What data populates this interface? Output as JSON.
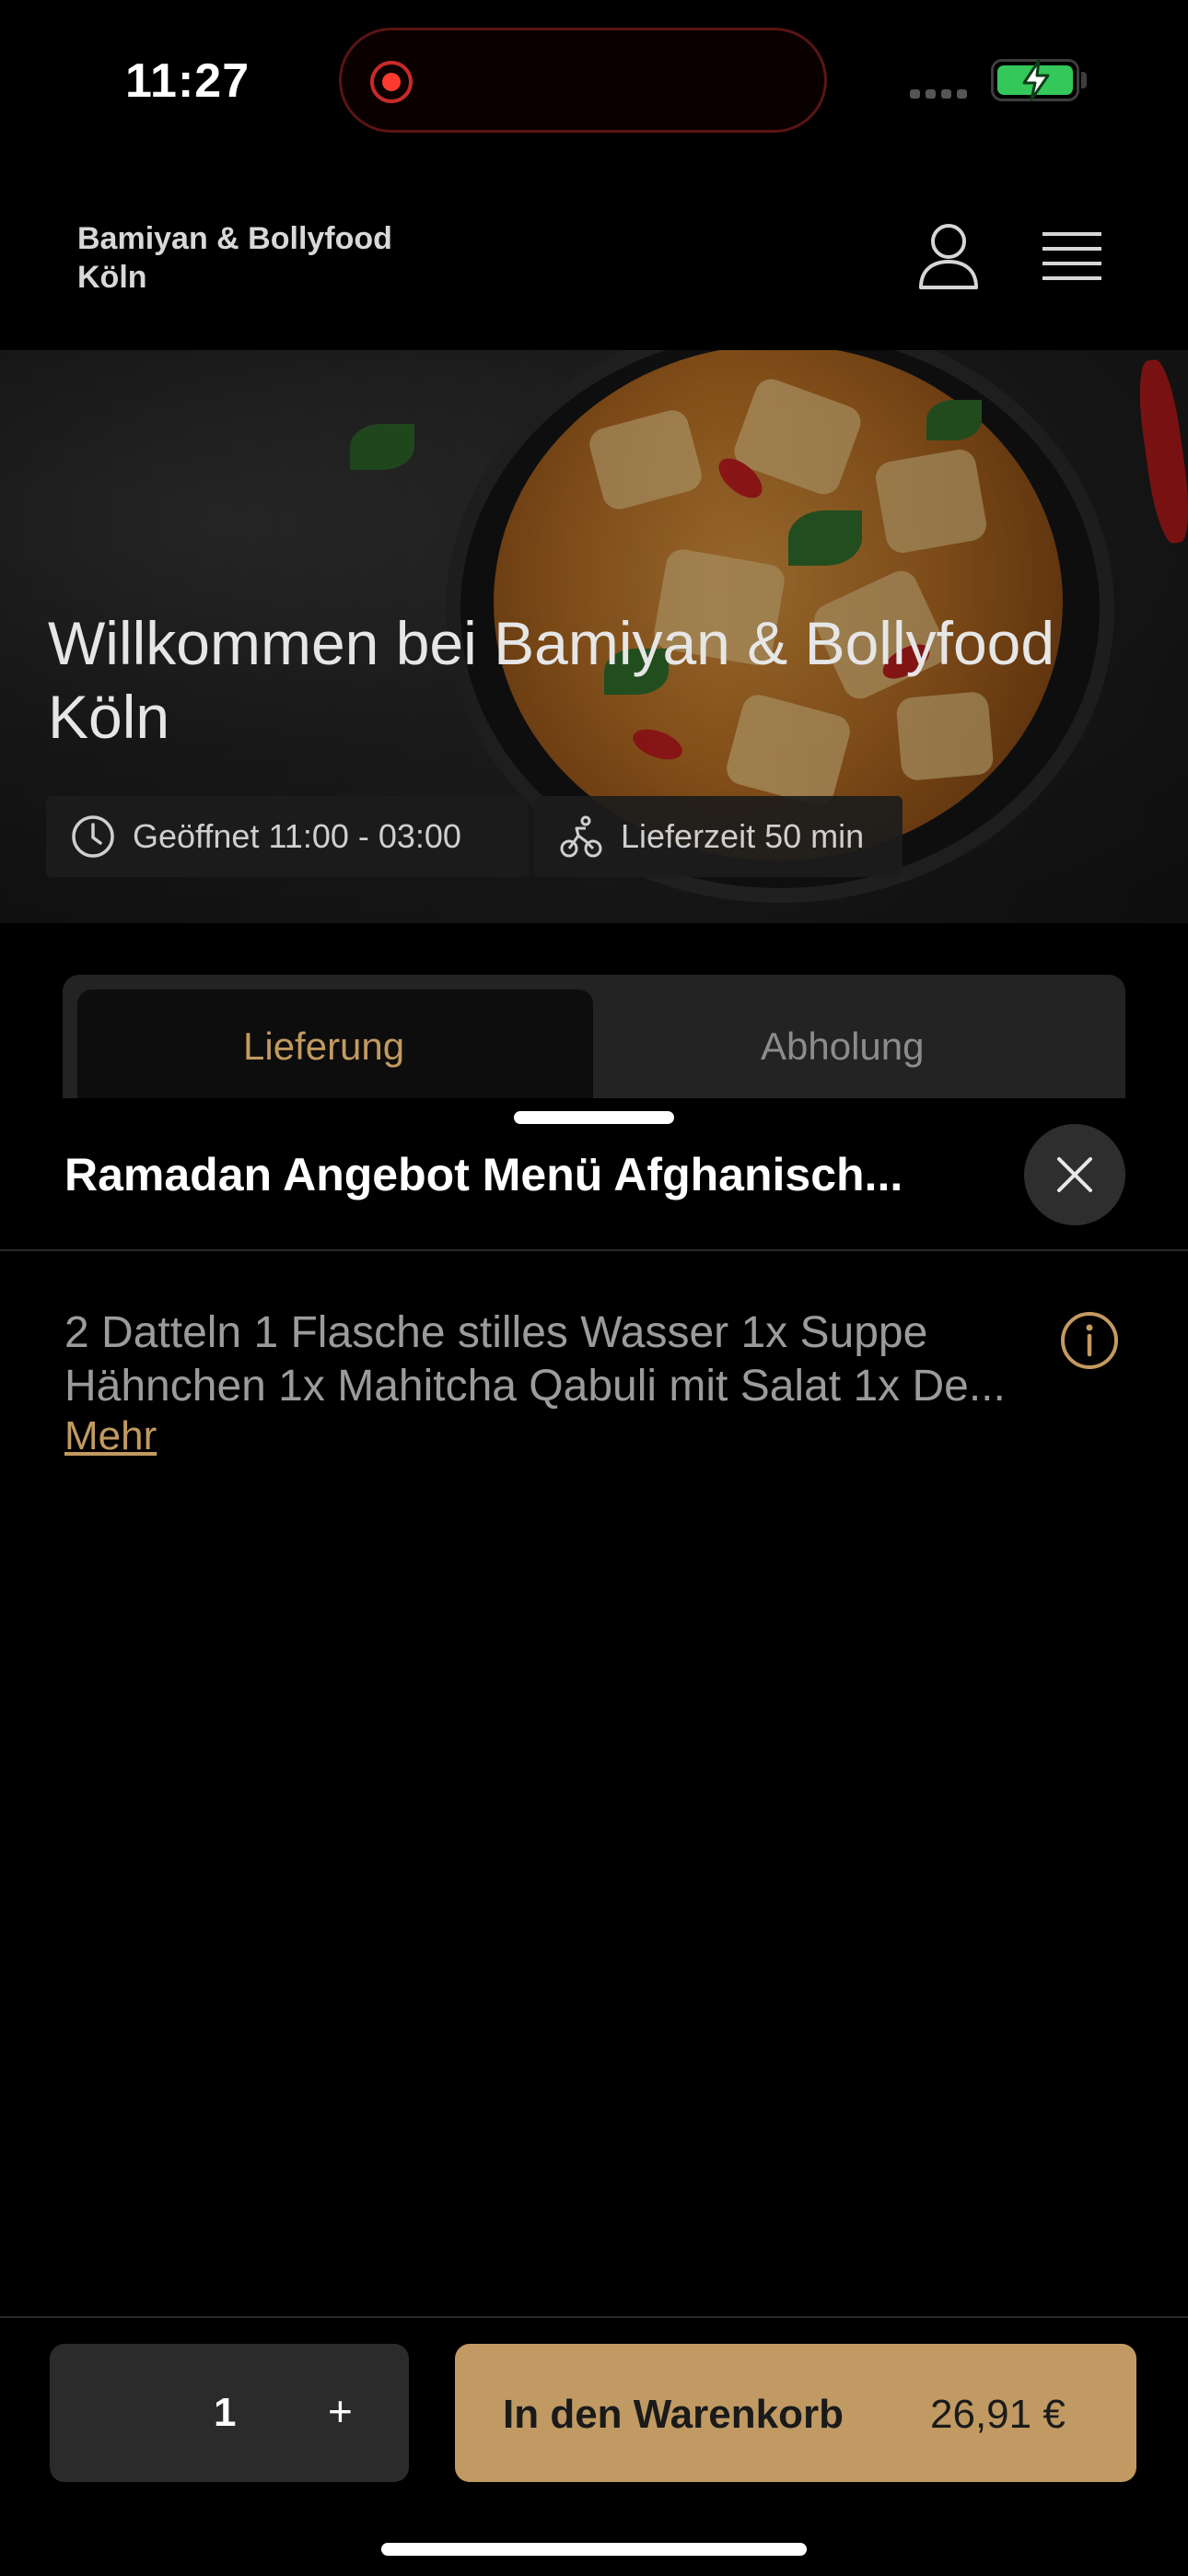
{
  "status_bar": {
    "time": "11:27",
    "icons": [
      "recording-indicator-icon",
      "cellular-signal-icon",
      "battery-charging-icon"
    ],
    "battery_color": "#34c759",
    "record_color": "#ff3b30"
  },
  "header": {
    "brand_line1": "Bamiyan & Bollyfood",
    "brand_line2": "Köln",
    "icons": [
      "user-icon",
      "hamburger-menu-icon"
    ]
  },
  "hero": {
    "title": "Willkommen bei Bamiyan & Bollyfood Köln",
    "opening_hours": "Geöffnet 11:00 - 03:00",
    "delivery_time": "Lieferzeit 50 min",
    "icons": [
      "clock-icon",
      "cyclist-icon"
    ]
  },
  "tabs": {
    "delivery": "Lieferung",
    "pickup": "Abholung",
    "active": "Lieferung",
    "active_color": "#c29a60"
  },
  "sheet": {
    "title": "Ramadan Angebot Menü Afghanisch...",
    "description_line1": "2 Datteln 1 Flasche stilles Wasser 1x Suppe",
    "description_line2": "Hähnchen 1x Mahitcha Qabuli mit Salat 1x De...",
    "more_link": "Mehr",
    "icons": [
      "close-icon",
      "info-icon"
    ]
  },
  "footer": {
    "quantity": "1",
    "increment_label": "+",
    "add_to_cart_label": "In den Warenkorb",
    "price": "26,91 €",
    "accent_color": "#c09a62"
  }
}
